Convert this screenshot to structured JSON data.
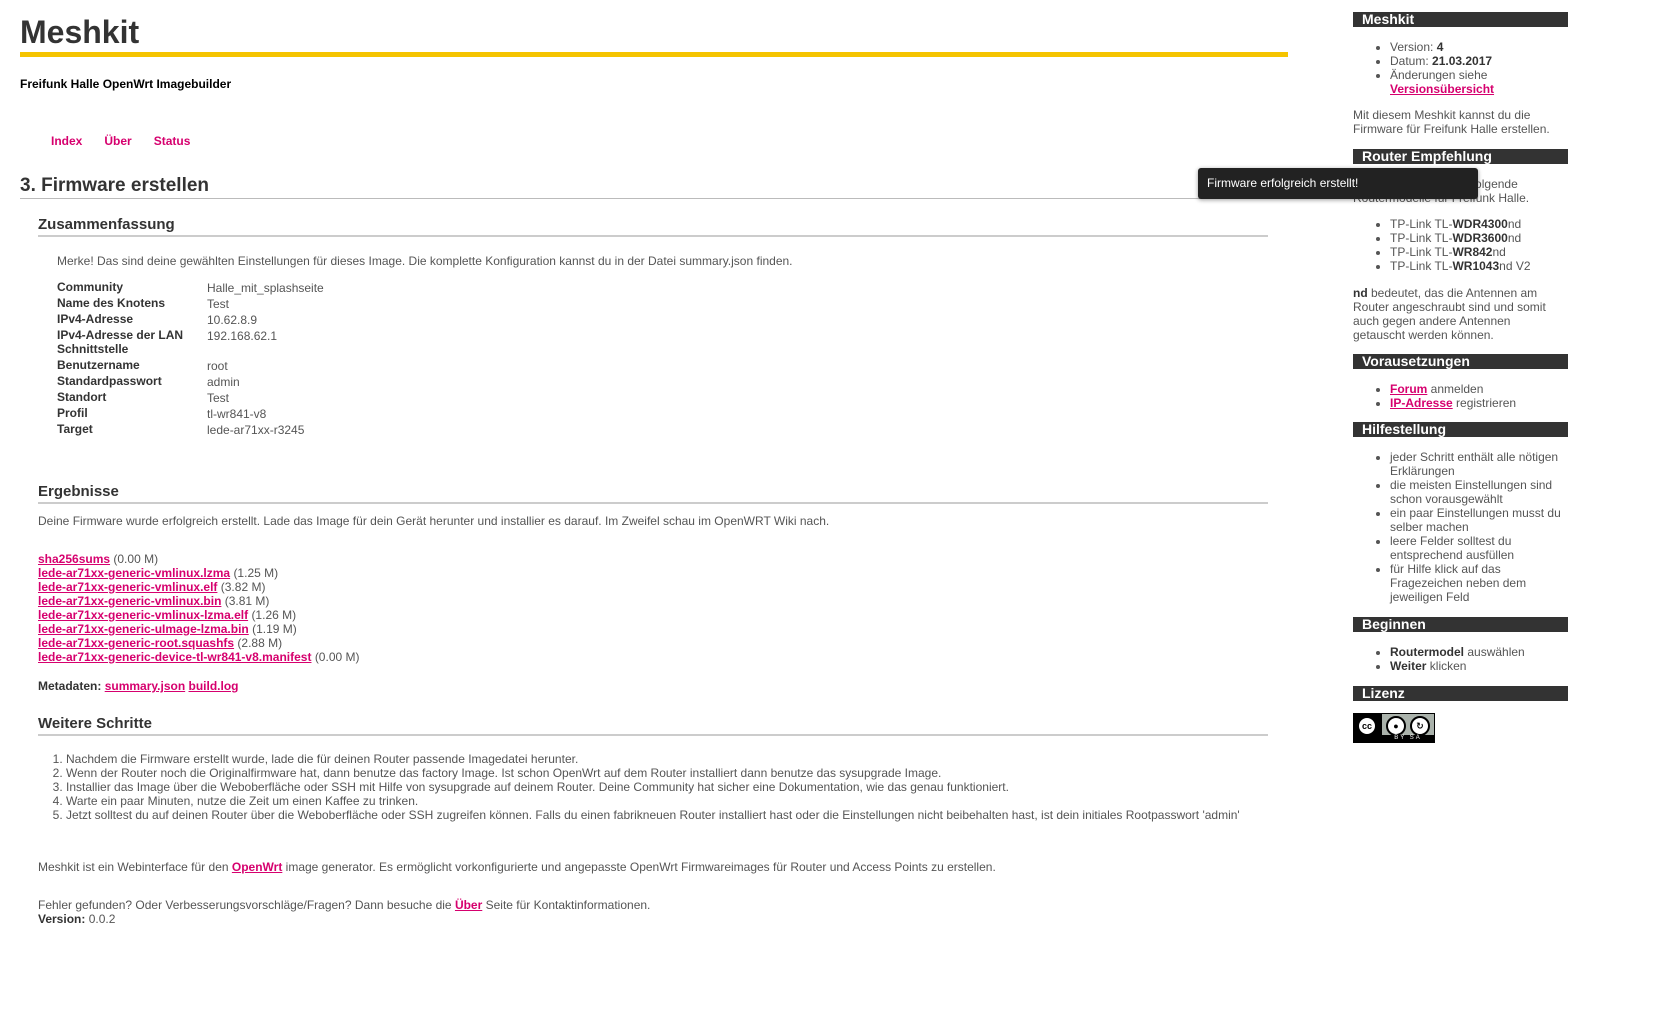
{
  "header": {
    "title": "Meshkit",
    "subtitle": "Freifunk Halle OpenWrt Imagebuilder",
    "nav": [
      "Index",
      "Über",
      "Status"
    ]
  },
  "page": {
    "heading": "3. Firmware erstellen"
  },
  "summary": {
    "heading": "Zusammenfassung",
    "intro": "Merke! Das sind deine gewählten Einstellungen für dieses Image. Die komplette Konfiguration kannst du in der Datei summary.json finden.",
    "rows": [
      {
        "key": "Community",
        "value": "Halle_mit_splashseite"
      },
      {
        "key": "Name des Knotens",
        "value": "Test"
      },
      {
        "key": "IPv4-Adresse",
        "value": "10.62.8.9"
      },
      {
        "key": "IPv4-Adresse der LAN Schnittstelle",
        "value": "192.168.62.1"
      },
      {
        "key": "Benutzername",
        "value": "root"
      },
      {
        "key": "Standardpasswort",
        "value": "admin"
      },
      {
        "key": "Standort",
        "value": "Test"
      },
      {
        "key": "Profil",
        "value": "tl-wr841-v8"
      },
      {
        "key": "Target",
        "value": "lede-ar71xx-r3245"
      }
    ]
  },
  "results": {
    "heading": "Ergebnisse",
    "text": "Deine Firmware wurde erfolgreich erstellt. Lade das Image für dein Gerät herunter und installier es darauf. Im Zweifel schau im OpenWRT Wiki nach.",
    "files": [
      {
        "name": "sha256sums",
        "size": "(0.00 M)"
      },
      {
        "name": "lede-ar71xx-generic-vmlinux.lzma",
        "size": "(1.25 M)"
      },
      {
        "name": "lede-ar71xx-generic-vmlinux.elf",
        "size": "(3.82 M)"
      },
      {
        "name": "lede-ar71xx-generic-vmlinux.bin",
        "size": "(3.81 M)"
      },
      {
        "name": "lede-ar71xx-generic-vmlinux-lzma.elf",
        "size": "(1.26 M)"
      },
      {
        "name": "lede-ar71xx-generic-uImage-lzma.bin",
        "size": "(1.19 M)"
      },
      {
        "name": "lede-ar71xx-generic-root.squashfs",
        "size": "(2.88 M)"
      },
      {
        "name": "lede-ar71xx-generic-device-tl-wr841-v8.manifest",
        "size": "(0.00 M)"
      }
    ],
    "meta_label": "Metadaten:",
    "meta_links": [
      "summary.json",
      "build.log"
    ]
  },
  "next_steps": {
    "heading": "Weitere Schritte",
    "items": [
      "Nachdem die Firmware erstellt wurde, lade die für deinen Router passende Imagedatei herunter.",
      "Wenn der Router noch die Originalfirmware hat, dann benutze das factory Image. Ist schon OpenWrt auf dem Router installiert dann benutze das sysupgrade Image.",
      "Installier das Image über die Weboberfläche oder SSH mit Hilfe von sysupgrade auf deinem Router. Deine Community hat sicher eine Dokumentation, wie das genau funktioniert.",
      "Warte ein paar Minuten, nutze die Zeit um einen Kaffee zu trinken.",
      "Jetzt solltest du auf deinen Router über die Weboberfläche oder SSH zugreifen können. Falls du einen fabrikneuen Router installiert hast oder die Einstellungen nicht beibehalten hast, ist dein initiales Rootpasswort 'admin'"
    ]
  },
  "footer": {
    "about_before": "Meshkit ist ein Webinterface für den ",
    "about_link": "OpenWrt",
    "about_after": " image generator. Es ermöglicht vorkonfigurierte und angepasste OpenWrt Firmwareimages für Router und Access Points zu erstellen.",
    "error_before": "Fehler gefunden? Oder Verbesserungsvorschläge/Fragen? Dann besuche die ",
    "error_link": "Über",
    "error_after": " Seite für Kontaktinformationen.",
    "version_label": "Version:",
    "version_value": " 0.0.2"
  },
  "sidebar": {
    "meshkit": {
      "heading": "Meshkit",
      "version_label": "Version: ",
      "version_value": "4",
      "date_label": "Datum: ",
      "date_value": "21.03.2017",
      "changes_text": "Änderungen siehe ",
      "changes_link": "Versionsübersicht",
      "description": "Mit diesem Meshkit kannst du die Firmware für Freifunk Halle erstellen."
    },
    "router": {
      "heading": "Router Empfehlung",
      "intro": "Wir empfehlen aktuell folgende Routermodelle für Freifunk Halle.",
      "models": [
        {
          "prefix": "TP-Link TL-",
          "model": "WDR4300",
          "suffix": "nd"
        },
        {
          "prefix": "TP-Link TL-",
          "model": "WDR3600",
          "suffix": "nd"
        },
        {
          "prefix": "TP-Link TL-",
          "model": "WR842",
          "suffix": "nd"
        },
        {
          "prefix": "TP-Link TL-",
          "model": "WR1043",
          "suffix": "nd V2"
        }
      ],
      "nd_label": "nd",
      "nd_text": " bedeutet, das die Antennen am Router angeschraubt sind und somit auch gegen andere Antennen getauscht werden können."
    },
    "requirements": {
      "heading": "Vorausetzungen",
      "items": [
        {
          "link": "Forum",
          "text": " anmelden"
        },
        {
          "link": "IP-Adresse",
          "text": " registrieren"
        }
      ]
    },
    "help": {
      "heading": "Hilfestellung",
      "items": [
        "jeder Schritt enthält alle nötigen Erklärungen",
        "die meisten Einstellungen sind schon vorausgewählt",
        "ein paar Einstellungen musst du selber machen",
        "leere Felder solltest du entsprechend ausfüllen",
        "für Hilfe klick auf das Fragezeichen neben dem jeweiligen Feld"
      ]
    },
    "begin": {
      "heading": "Beginnen",
      "items": [
        {
          "bold": "Routermodel",
          "text": " auswählen"
        },
        {
          "bold": "Weiter",
          "text": " klicken"
        }
      ]
    },
    "license": {
      "heading": "Lizenz",
      "badge_cc": "cc",
      "badge_text": "BY SA"
    }
  },
  "toast": {
    "message": "Firmware erfolgreich erstellt!"
  }
}
